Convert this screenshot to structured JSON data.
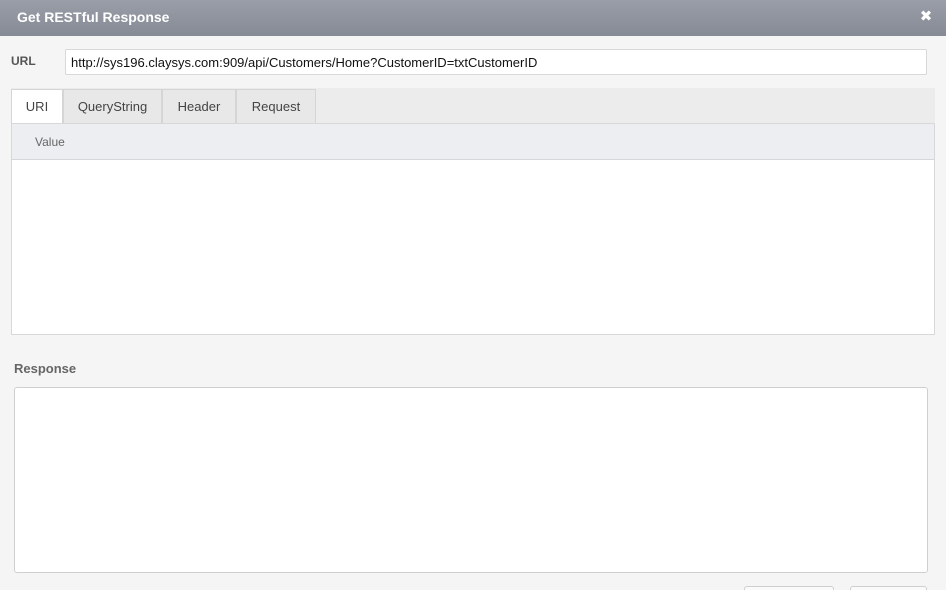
{
  "dialog": {
    "title": "Get RESTful Response",
    "close_glyph": "✖"
  },
  "url": {
    "label": "URL",
    "value": "http://sys196.claysys.com:909/api/Customers/Home?CustomerID=txtCustomerID"
  },
  "tabs": [
    {
      "label": "URI",
      "active": true
    },
    {
      "label": "QueryString",
      "active": false
    },
    {
      "label": "Header",
      "active": false
    },
    {
      "label": "Request",
      "active": false
    }
  ],
  "grid": {
    "columns": [
      "Value"
    ],
    "rows": []
  },
  "response": {
    "label": "Response",
    "value": ""
  },
  "icons": {
    "close": "close-icon"
  }
}
